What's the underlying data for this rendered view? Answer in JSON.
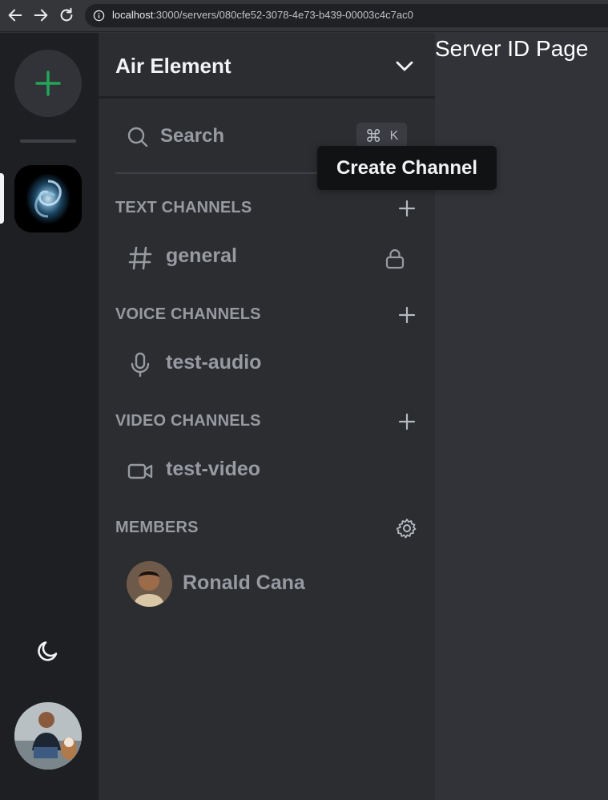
{
  "browser": {
    "url_host": "localhost",
    "url_rest": ":3000/servers/080cfe52-3078-4e73-b439-00003c4c7ac0"
  },
  "rail": {
    "add_server_icon": "plus-icon",
    "server_icon": "galaxy-image",
    "theme_toggle_icon": "moon-icon",
    "accent_color": "#23a55a"
  },
  "sidebar": {
    "server_name": "Air Element",
    "search": {
      "label": "Search",
      "shortcut_symbol": "⌘",
      "shortcut_key": "K"
    },
    "sections": {
      "text": {
        "label": "TEXT CHANNELS",
        "channels": [
          {
            "name": "general",
            "icon": "hash-icon",
            "locked": true
          }
        ]
      },
      "voice": {
        "label": "VOICE CHANNELS",
        "channels": [
          {
            "name": "test-audio",
            "icon": "mic-icon"
          }
        ]
      },
      "video": {
        "label": "VIDEO CHANNELS",
        "channels": [
          {
            "name": "test-video",
            "icon": "video-icon"
          }
        ]
      },
      "members": {
        "label": "MEMBERS",
        "items": [
          {
            "name": "Ronald Cana"
          }
        ]
      }
    }
  },
  "tooltip": {
    "text": "Create Channel"
  },
  "main": {
    "title": "Server ID Page"
  }
}
